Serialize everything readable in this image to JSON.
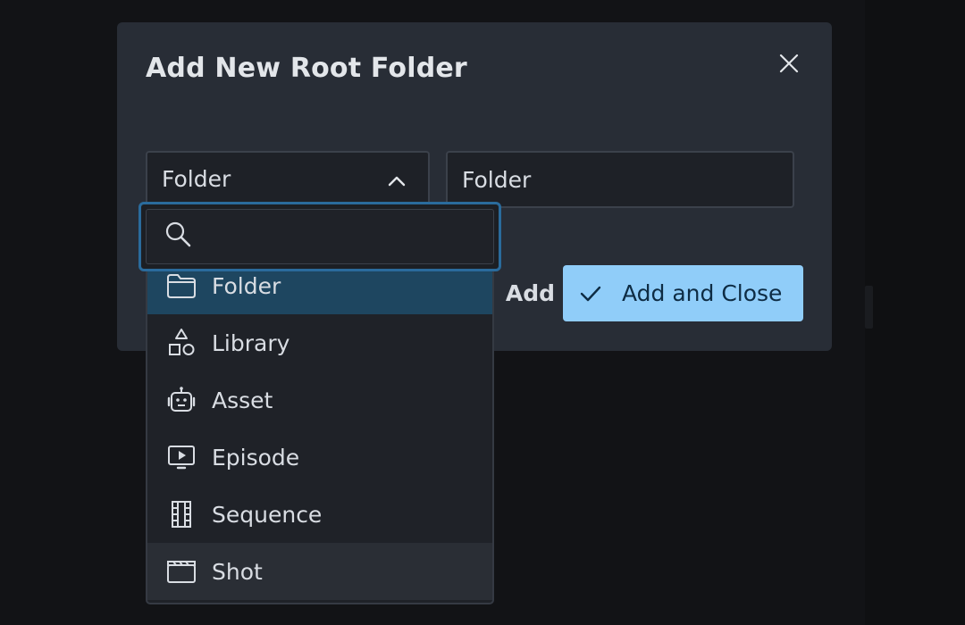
{
  "dialog": {
    "title": "Add New Root Folder"
  },
  "type_select": {
    "value": "Folder",
    "expanded": true
  },
  "name_field": {
    "value": "Folder",
    "placeholder": ""
  },
  "actions": {
    "add_label": "Add",
    "add_close_label": "Add and Close"
  },
  "dropdown": {
    "search_value": "",
    "items": [
      {
        "label": "Folder",
        "icon": "folder-icon"
      },
      {
        "label": "Library",
        "icon": "shapes-icon"
      },
      {
        "label": "Asset",
        "icon": "robot-icon"
      },
      {
        "label": "Episode",
        "icon": "play-screen-icon"
      },
      {
        "label": "Sequence",
        "icon": "film-strip-icon"
      },
      {
        "label": "Shot",
        "icon": "clapperboard-icon"
      }
    ],
    "selected": "Folder",
    "hovered": "Shot"
  },
  "colors": {
    "accent": "#90cdf9",
    "selected_row": "#1e4660",
    "focus_ring": "#2a6b9c"
  }
}
